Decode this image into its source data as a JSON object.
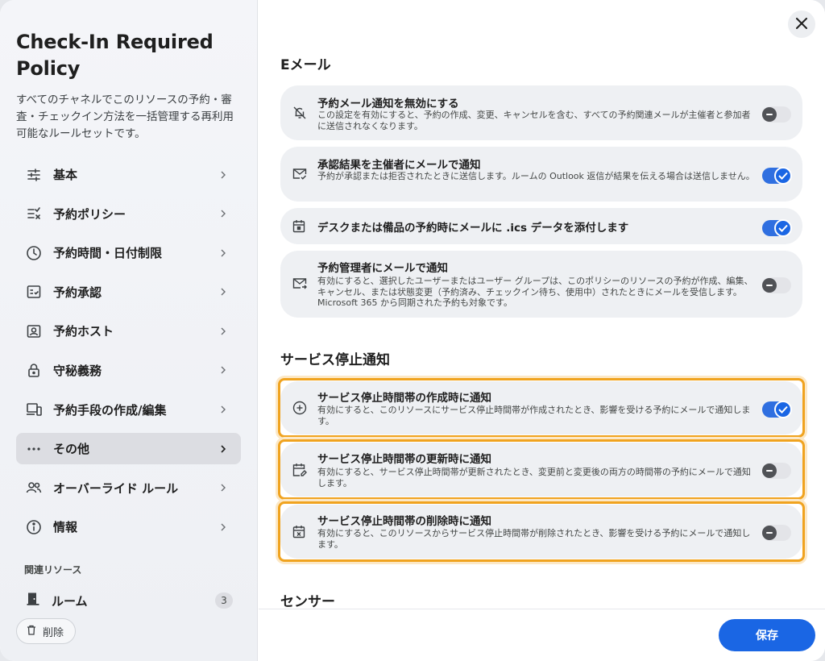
{
  "sidebar": {
    "title": "Check-In Required Policy",
    "description": "すべてのチャネルでこのリソースの予約・審査・チェックイン方法を一括管理する再利用可能なルールセットです。",
    "nav": [
      {
        "label": "基本",
        "icon": "sliders-icon"
      },
      {
        "label": "予約ポリシー",
        "icon": "checklist-icon"
      },
      {
        "label": "予約時間・日付制限",
        "icon": "clock-icon"
      },
      {
        "label": "予約承認",
        "icon": "approval-icon"
      },
      {
        "label": "予約ホスト",
        "icon": "host-icon"
      },
      {
        "label": "守秘義務",
        "icon": "lock-icon"
      },
      {
        "label": "予約手段の作成/編集",
        "icon": "devices-icon"
      },
      {
        "label": "その他",
        "icon": "more-icon",
        "active": true
      },
      {
        "label": "オーバーライド ルール",
        "icon": "people-icon"
      },
      {
        "label": "情報",
        "icon": "info-icon"
      }
    ],
    "related_heading": "関連リソース",
    "related": {
      "label": "ルーム",
      "count": "3"
    },
    "delete_label": "削除"
  },
  "main": {
    "email_heading": "Eメール",
    "email_cards": [
      {
        "title": "予約メール通知を無効にする",
        "desc": "この設定を有効にすると、予約の作成、変更、キャンセルを含む、すべての予約関連メールが主催者と参加者に送信されなくなります。",
        "on": false,
        "icon": "bell-off-icon"
      },
      {
        "title": "承認結果を主催者にメールで通知",
        "desc": "予約が承認または拒否されたときに送信します。ルームの Outlook 返信が結果を伝える場合は送信しません。",
        "on": true,
        "icon": "mail-check-icon"
      },
      {
        "title": "デスクまたは備品の予約時にメールに .ics データを添付します",
        "desc": "",
        "on": true,
        "icon": "calendar-icon"
      },
      {
        "title": "予約管理者にメールで通知",
        "desc": "有効にすると、選択したユーザーまたはユーザー グループは、このポリシーのリソースの予約が作成、編集、キャンセル、または状態変更（予約済み、チェックイン待ち、使用中）されたときにメールを受信します。Microsoft 365 から同期された予約も対象です。",
        "on": false,
        "icon": "mail-forward-icon"
      }
    ],
    "outage_heading": "サービス停止通知",
    "outage_cards": [
      {
        "title": "サービス停止時間帯の作成時に通知",
        "desc": "有効にすると、このリソースにサービス停止時間帯が作成されたとき、影響を受ける予約にメールで通知します。",
        "on": true,
        "icon": "plus-circle-icon"
      },
      {
        "title": "サービス停止時間帯の更新時に通知",
        "desc": "有効にすると、サービス停止時間帯が更新されたとき、変更前と変更後の両方の時間帯の予約にメールで通知します。",
        "on": false,
        "icon": "calendar-edit-icon"
      },
      {
        "title": "サービス停止時間帯の削除時に通知",
        "desc": "有効にすると、このリソースからサービス停止時間帯が削除されたとき、影響を受ける予約にメールで通知します。",
        "on": false,
        "icon": "calendar-x-icon"
      }
    ],
    "sensor_heading": "センサー",
    "save_label": "保存"
  },
  "colors": {
    "accent": "#1a66e4",
    "highlight": "#f0a31f"
  }
}
